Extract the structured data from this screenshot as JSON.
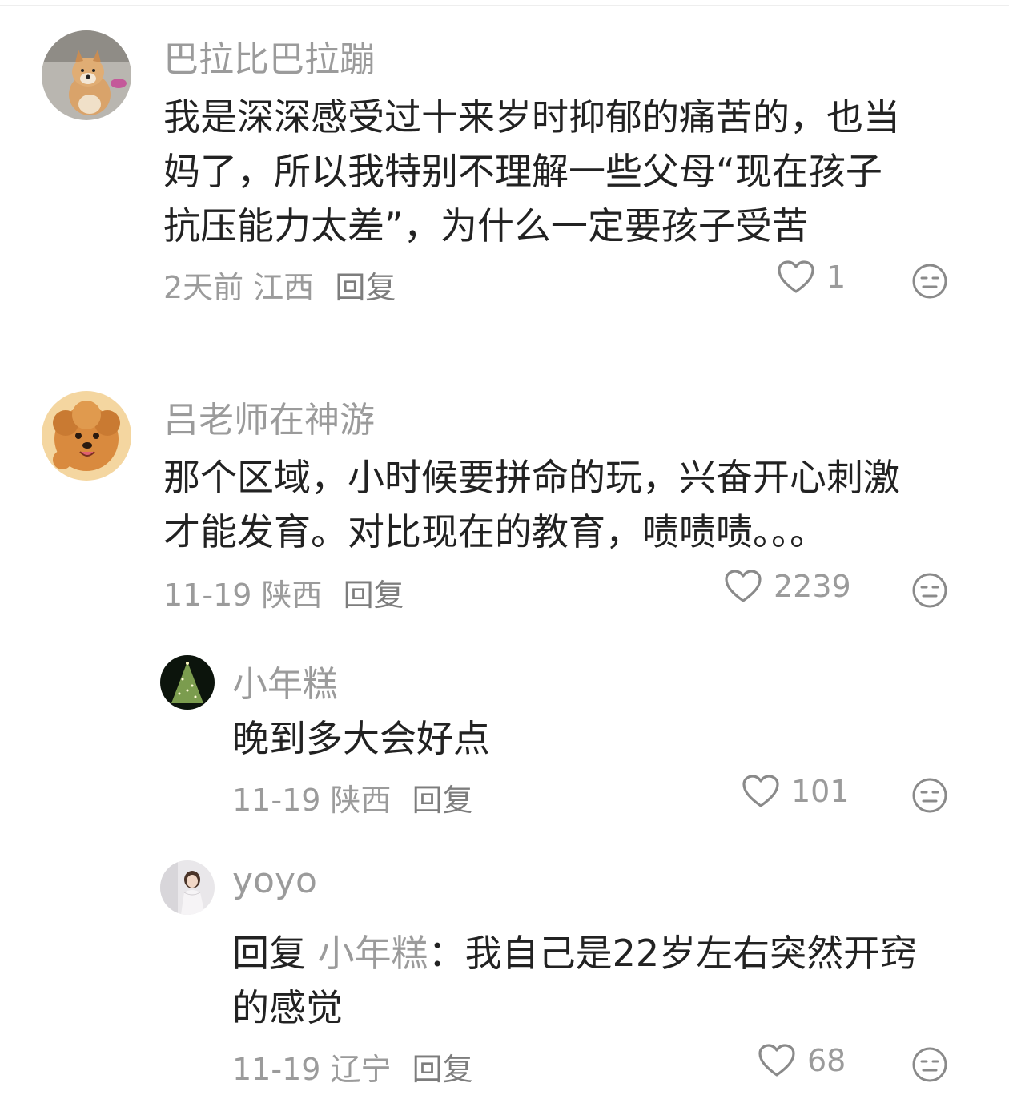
{
  "comments": [
    {
      "username": "巴拉比巴拉蹦",
      "text_lines": [
        "我是深深感受过十来岁时抑郁的痛苦的，也当",
        "妈了，所以我特别不理解一些父母“现在孩子",
        "抗压能力太差”，为什么一定要孩子受苦"
      ],
      "time": "2天前",
      "location": "江西",
      "reply_label": "回复",
      "likes": "1",
      "avatar_icon": "shiba-dog-avatar"
    },
    {
      "username": "吕老师在神游",
      "text_lines": [
        "那个区域，小时候要拼命的玩，兴奋开心刺激",
        "才能发育。对比现在的教育，啧啧啧。。。"
      ],
      "time": "11-19",
      "location": "陕西",
      "reply_label": "回复",
      "likes": "2239",
      "avatar_icon": "poodle-dog-avatar"
    }
  ],
  "replies": [
    {
      "username": "小年糕",
      "text_lines": [
        "晚到多大会好点"
      ],
      "time": "11-19",
      "location": "陕西",
      "reply_label": "回复",
      "likes": "101",
      "avatar_icon": "christmas-tree-avatar"
    },
    {
      "username": "yoyo",
      "reply_prefix": "回复",
      "reply_to": "小年糕",
      "reply_colon": "：",
      "text_first": "我自己是22岁左右突然开窍",
      "text_second": "的感觉",
      "time": "11-19",
      "location": "辽宁",
      "reply_label": "回复",
      "likes": "68",
      "avatar_icon": "girl-photo-avatar"
    }
  ],
  "colors": {
    "username": "#9b9b9b",
    "body": "#222222",
    "meta": "#9b9b9b",
    "icon_stroke": "#8a8a8a"
  }
}
